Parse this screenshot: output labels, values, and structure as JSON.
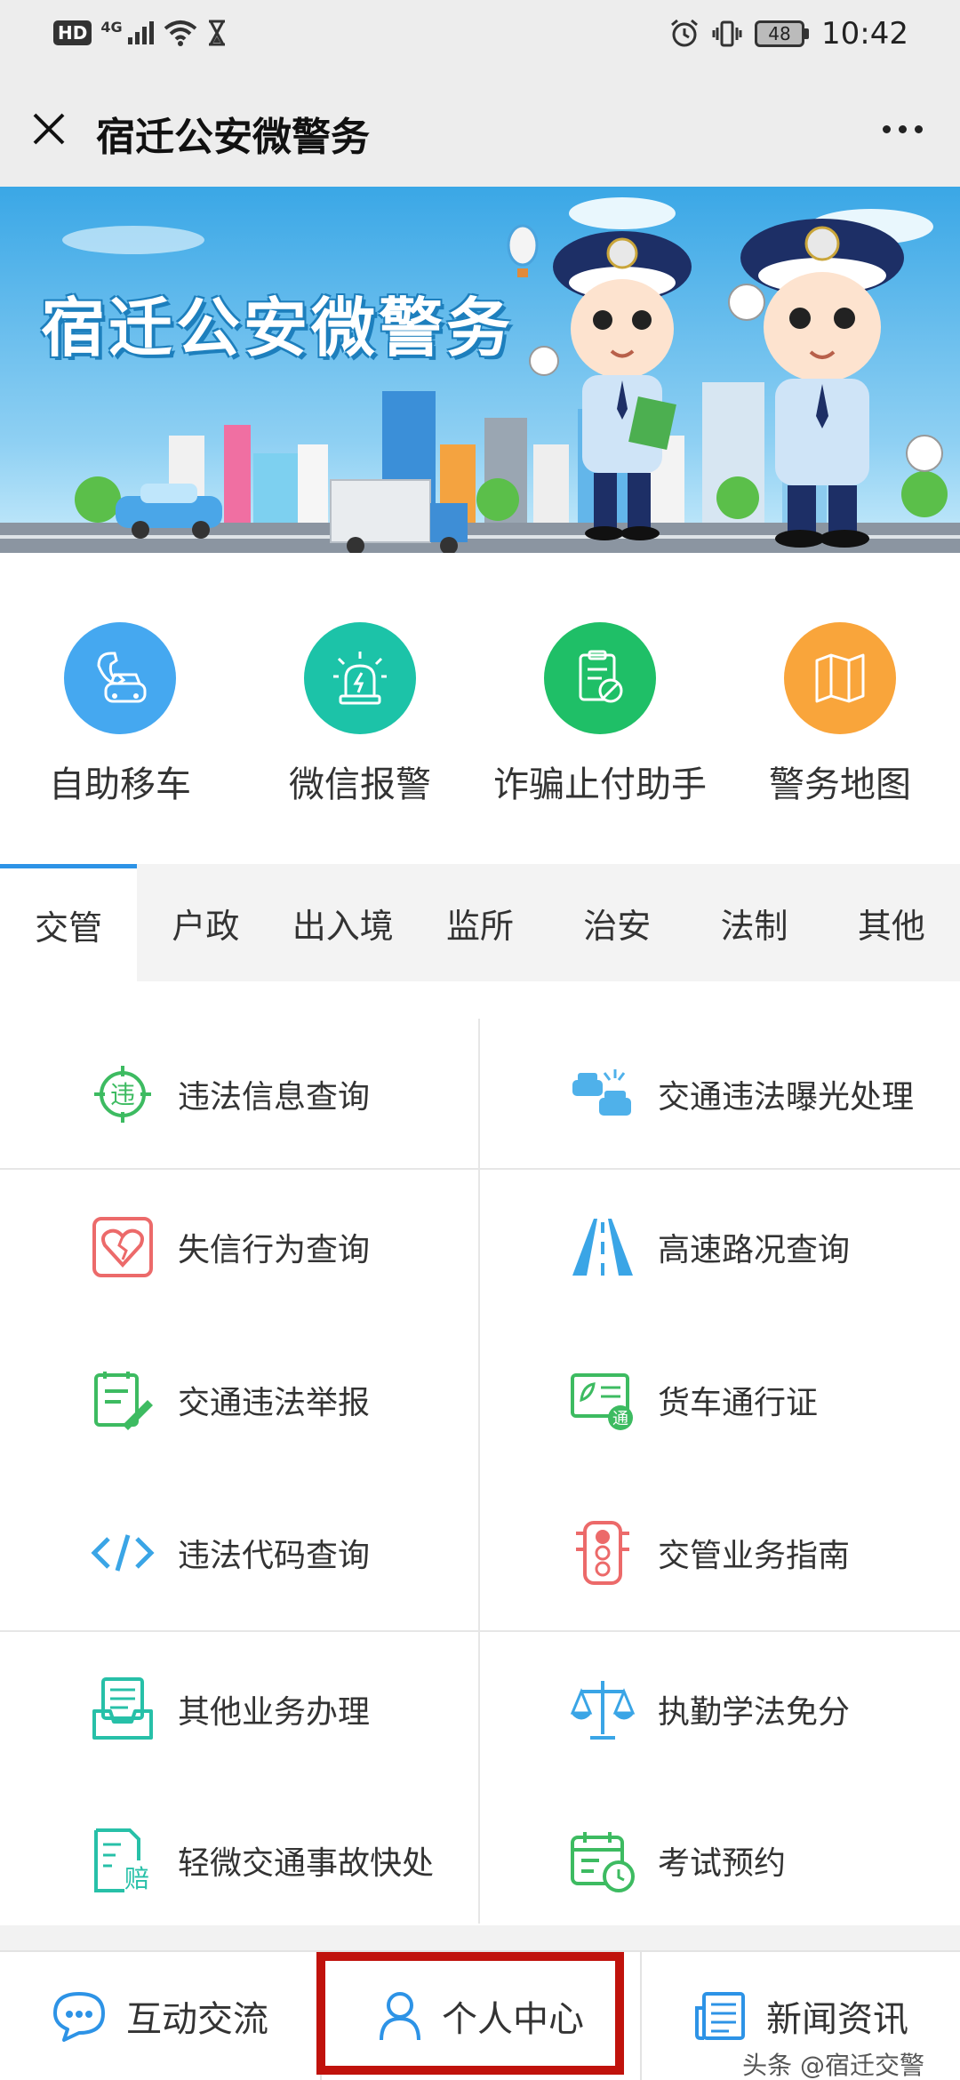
{
  "status_bar": {
    "hd": "HD",
    "network": "4G",
    "battery": "48",
    "time": "10:42"
  },
  "header": {
    "title": "宿迁公安微警务"
  },
  "banner": {
    "title": "宿迁公安微警务"
  },
  "quick_services": [
    {
      "label": "自助移车",
      "icon": "car-phone-icon",
      "color": "#45a8f0"
    },
    {
      "label": "微信报警",
      "icon": "alarm-light-icon",
      "color": "#1cc3a8"
    },
    {
      "label": "诈骗止付助手",
      "icon": "clipboard-block-icon",
      "color": "#1fbf67"
    },
    {
      "label": "警务地图",
      "icon": "map-icon",
      "color": "#f9a53b"
    }
  ],
  "tabs": [
    {
      "label": "交管",
      "active": true
    },
    {
      "label": "户政"
    },
    {
      "label": "出入境"
    },
    {
      "label": "监所"
    },
    {
      "label": "治安"
    },
    {
      "label": "法制"
    },
    {
      "label": "其他"
    }
  ],
  "services": [
    {
      "label": "违法信息查询",
      "icon": "violation-target-icon"
    },
    {
      "label": "交通违法曝光处理",
      "icon": "car-collision-icon"
    },
    {
      "label": "失信行为查询",
      "icon": "broken-heart-icon"
    },
    {
      "label": "高速路况查询",
      "icon": "highway-icon"
    },
    {
      "label": "交通违法举报",
      "icon": "report-pen-icon"
    },
    {
      "label": "货车通行证",
      "icon": "truck-pass-icon"
    },
    {
      "label": "违法代码查询",
      "icon": "code-icon"
    },
    {
      "label": "交管业务指南",
      "icon": "traffic-light-icon"
    },
    {
      "label": "其他业务办理",
      "icon": "inbox-icon"
    },
    {
      "label": "执勤学法免分",
      "icon": "scales-icon"
    },
    {
      "label": "轻微交通事故快处",
      "icon": "claim-doc-icon"
    },
    {
      "label": "考试预约",
      "icon": "calendar-clock-icon"
    }
  ],
  "bottom_nav": [
    {
      "label": "互动交流",
      "icon": "chat-bubble-icon"
    },
    {
      "label": "个人中心",
      "icon": "person-icon"
    },
    {
      "label": "新闻资讯",
      "icon": "news-icon"
    }
  ],
  "watermark": "头条 @宿迁交警",
  "colors": {
    "accent": "#2d93e6",
    "highlight": "#c0120c"
  }
}
